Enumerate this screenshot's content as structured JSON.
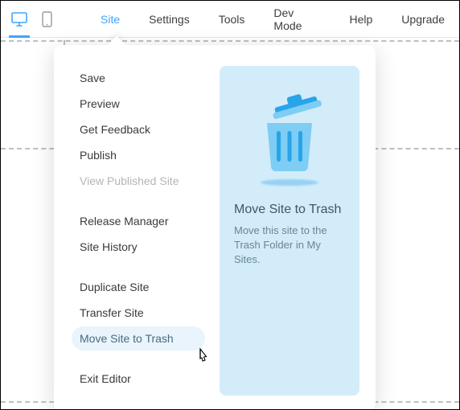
{
  "topbar": {
    "menus": [
      "Site",
      "Settings",
      "Tools",
      "Dev Mode",
      "Help",
      "Upgrade"
    ],
    "activeIndex": 0
  },
  "siteMenu": {
    "groups": [
      [
        {
          "label": "Save",
          "disabled": false
        },
        {
          "label": "Preview",
          "disabled": false
        },
        {
          "label": "Get Feedback",
          "disabled": false
        },
        {
          "label": "Publish",
          "disabled": false
        },
        {
          "label": "View Published Site",
          "disabled": true
        }
      ],
      [
        {
          "label": "Release Manager",
          "disabled": false
        },
        {
          "label": "Site History",
          "disabled": false
        }
      ],
      [
        {
          "label": "Duplicate Site",
          "disabled": false
        },
        {
          "label": "Transfer Site",
          "disabled": false
        },
        {
          "label": "Move Site to Trash",
          "disabled": false,
          "hovered": true
        }
      ],
      [
        {
          "label": "Exit Editor",
          "disabled": false
        }
      ]
    ]
  },
  "detail": {
    "title": "Move Site to Trash",
    "description": "Move this site to the Trash Folder in My Sites."
  }
}
